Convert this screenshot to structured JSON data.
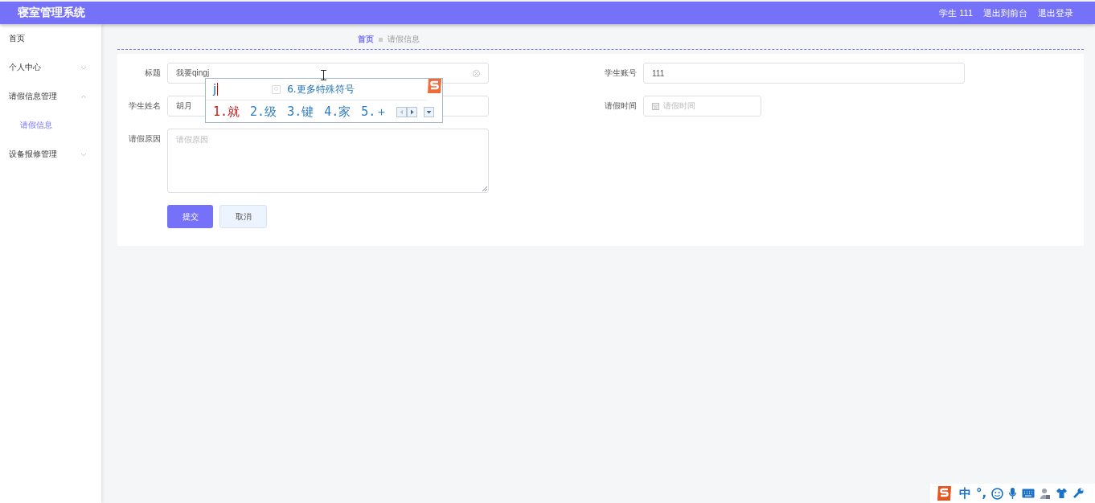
{
  "header": {
    "title": "寝室管理系统",
    "user": "学生 111",
    "links": [
      "退出到前台",
      "退出登录"
    ]
  },
  "sidebar": {
    "items": [
      {
        "label": "首页",
        "selected": false
      },
      {
        "label": "个人中心",
        "expanded": false
      },
      {
        "label": "请假信息管理",
        "expanded": true,
        "children": [
          {
            "label": "请假信息",
            "selected": true
          }
        ]
      },
      {
        "label": "设备报修管理",
        "expanded": false
      }
    ]
  },
  "breadcrumb": [
    "首页",
    "请假信息"
  ],
  "form": {
    "rows": [
      [
        {
          "label": "标题",
          "kind": "text",
          "value": "我要qingj",
          "clearable": true
        },
        {
          "label": "学生账号",
          "kind": "text",
          "value": "111"
        }
      ],
      [
        {
          "label": "学生姓名",
          "kind": "text",
          "value": "胡月"
        },
        {
          "label": "请假时间",
          "kind": "date",
          "placeholder": "请假时间"
        }
      ],
      [
        {
          "label": "请假原因",
          "kind": "textarea",
          "placeholder": "请假原因"
        }
      ]
    ],
    "buttons": [
      {
        "label": "提交",
        "kind": "primary"
      },
      {
        "label": "取消",
        "kind": "plain"
      }
    ]
  },
  "ime": {
    "composition": "j",
    "extra": "6.更多特殊符号",
    "candidates": [
      {
        "label": "1.就",
        "selected": true
      },
      {
        "label": "2.级",
        "selected": false
      },
      {
        "label": "3.键",
        "selected": false
      },
      {
        "label": "4.家",
        "selected": false
      },
      {
        "label": "5.＋",
        "selected": false
      }
    ]
  },
  "ime_toolbar": {
    "mode": "中",
    "punctuation": "°,"
  }
}
